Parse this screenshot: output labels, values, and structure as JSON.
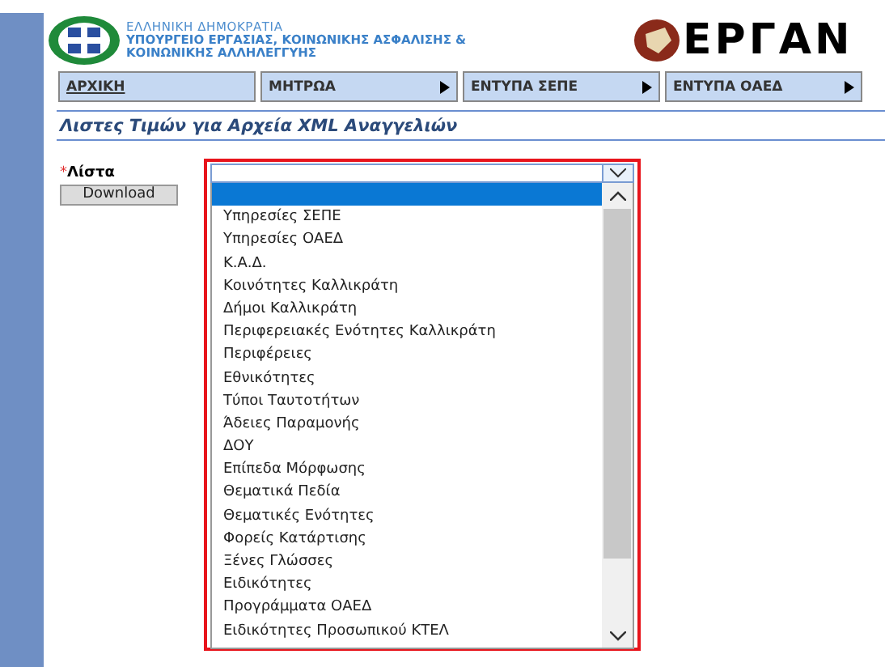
{
  "header": {
    "country": "ΕΛΛΗΝΙΚΗ ΔΗΜΟΚΡΑΤΙΑ",
    "ministry": [
      "ΥΠΟΥΡΓΕΙΟ ΕΡΓΑΣΙΑΣ, ΚΟΙΝΩΝΙΚΗΣ ΑΣΦΑΛΙΣΗΣ &",
      "ΚΟΙΝΩΝΙΚΗΣ ΑΛΛΗΛΕΓΓΥΗΣ"
    ],
    "brand": "ΕΡΓΑΝ"
  },
  "menu": [
    {
      "label": "ΑΡΧΙΚΗ",
      "kind": "link"
    },
    {
      "label": "ΜΗΤΡΩΑ",
      "kind": "submenu"
    },
    {
      "label": "ΕΝΤΥΠΑ ΣΕΠΕ",
      "kind": "submenu"
    },
    {
      "label": "ΕΝΤΥΠΑ ΟΑΕΔ",
      "kind": "submenu"
    }
  ],
  "page_title": "Λιστες Τιμών για Αρχεία XML Αναγγελιών",
  "form": {
    "required_mark": "*",
    "label": "Λίστα",
    "button": "Download",
    "dropdown": {
      "expanded": true,
      "blank_highlighted": true,
      "options": [
        {
          "label": "Υπηρεσίες ΣΕΠΕ",
          "selected": false
        },
        {
          "label": "Υπηρεσίες ΟΑΕΔ",
          "selected": false
        },
        {
          "label": "Κ.Α.Δ.",
          "selected": false
        },
        {
          "label": "Κοινότητες Καλλικράτη",
          "selected": false
        },
        {
          "label": "Δήμοι Καλλικράτη",
          "selected": false
        },
        {
          "label": "Περιφερειακές Ενότητες Καλλικράτη",
          "selected": false
        },
        {
          "label": "Περιφέρειες",
          "selected": false
        },
        {
          "label": "Εθνικότητες",
          "selected": false
        },
        {
          "label": "Τύποι Ταυτοτήτων",
          "selected": false
        },
        {
          "label": "Άδειες Παραμονής",
          "selected": false
        },
        {
          "label": "ΔΟΥ",
          "selected": false
        },
        {
          "label": "Επίπεδα Μόρφωσης",
          "selected": false
        },
        {
          "label": "Θεματικά Πεδία",
          "selected": false
        },
        {
          "label": "Θεματικές Ενότητες",
          "selected": false
        },
        {
          "label": "Φορείς Κατάρτισης",
          "selected": false
        },
        {
          "label": "Ξένες Γλώσσες",
          "selected": false
        },
        {
          "label": "Ειδικότητες",
          "selected": false
        },
        {
          "label": "Προγράμματα ΟΑΕΔ",
          "selected": false
        },
        {
          "label": "Ειδικότητες Προσωπικού ΚΤΕΛ",
          "selected": false
        }
      ]
    }
  }
}
